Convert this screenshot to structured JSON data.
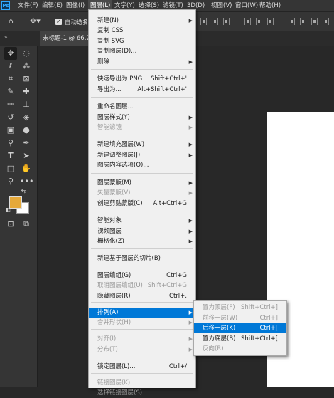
{
  "menubar": {
    "items": [
      "文件(F)",
      "编辑(E)",
      "图像(I)",
      "图层(L)",
      "文字(Y)",
      "选择(S)",
      "滤镜(T)",
      "3D(D)",
      "视图(V)",
      "窗口(W)",
      "帮助(H)"
    ]
  },
  "options": {
    "auto_select_label": "自动选择"
  },
  "document": {
    "tab_title": "未标题-1 @ 66.7"
  },
  "layer_menu": {
    "items": [
      {
        "label": "新建(N)",
        "shortcut": "",
        "arrow": true,
        "disabled": false
      },
      {
        "label": "复制 CSS",
        "shortcut": "",
        "arrow": false,
        "disabled": false
      },
      {
        "label": "复制 SVG",
        "shortcut": "",
        "arrow": false,
        "disabled": false
      },
      {
        "label": "复制图层(D)...",
        "shortcut": "",
        "arrow": false,
        "disabled": false
      },
      {
        "label": "删除",
        "shortcut": "",
        "arrow": true,
        "disabled": false
      },
      {
        "label": "快速导出为 PNG",
        "shortcut": "Shift+Ctrl+'",
        "arrow": false,
        "disabled": false
      },
      {
        "label": "导出为...",
        "shortcut": "Alt+Shift+Ctrl+'",
        "arrow": false,
        "disabled": false
      },
      {
        "label": "重命名图层...",
        "shortcut": "",
        "arrow": false,
        "disabled": false
      },
      {
        "label": "图层样式(Y)",
        "shortcut": "",
        "arrow": true,
        "disabled": false
      },
      {
        "label": "智能滤镜",
        "shortcut": "",
        "arrow": true,
        "disabled": true
      },
      {
        "label": "新建填充图层(W)",
        "shortcut": "",
        "arrow": true,
        "disabled": false
      },
      {
        "label": "新建调整图层(J)",
        "shortcut": "",
        "arrow": true,
        "disabled": false
      },
      {
        "label": "图层内容选项(O)...",
        "shortcut": "",
        "arrow": false,
        "disabled": false
      },
      {
        "label": "图层蒙版(M)",
        "shortcut": "",
        "arrow": true,
        "disabled": false
      },
      {
        "label": "矢量蒙版(V)",
        "shortcut": "",
        "arrow": true,
        "disabled": true
      },
      {
        "label": "创建剪贴蒙版(C)",
        "shortcut": "Alt+Ctrl+G",
        "arrow": false,
        "disabled": false
      },
      {
        "label": "智能对象",
        "shortcut": "",
        "arrow": true,
        "disabled": false
      },
      {
        "label": "视频图层",
        "shortcut": "",
        "arrow": true,
        "disabled": false
      },
      {
        "label": "栅格化(Z)",
        "shortcut": "",
        "arrow": true,
        "disabled": false
      },
      {
        "label": "新建基于图层的切片(B)",
        "shortcut": "",
        "arrow": false,
        "disabled": false
      },
      {
        "label": "图层编组(G)",
        "shortcut": "Ctrl+G",
        "arrow": false,
        "disabled": false
      },
      {
        "label": "取消图层编组(U)",
        "shortcut": "Shift+Ctrl+G",
        "arrow": false,
        "disabled": true
      },
      {
        "label": "隐藏图层(R)",
        "shortcut": "Ctrl+,",
        "arrow": false,
        "disabled": false
      },
      {
        "label": "排列(A)",
        "shortcut": "",
        "arrow": true,
        "disabled": false,
        "highlight": true
      },
      {
        "label": "合并形状(H)",
        "shortcut": "",
        "arrow": true,
        "disabled": true
      },
      {
        "label": "对齐(I)",
        "shortcut": "",
        "arrow": true,
        "disabled": true
      },
      {
        "label": "分布(T)",
        "shortcut": "",
        "arrow": true,
        "disabled": true
      },
      {
        "label": "锁定图层(L)...",
        "shortcut": "Ctrl+/",
        "arrow": false,
        "disabled": false
      },
      {
        "label": "链接图层(K)",
        "shortcut": "",
        "arrow": false,
        "disabled": true
      },
      {
        "label": "选择链接图层(S)",
        "shortcut": "",
        "arrow": false,
        "disabled": true
      }
    ]
  },
  "arrange_menu": {
    "items": [
      {
        "label": "置为顶层(F)",
        "shortcut": "Shift+Ctrl+]",
        "disabled": true
      },
      {
        "label": "前移一层(W)",
        "shortcut": "Ctrl+]",
        "disabled": true
      },
      {
        "label": "后移一层(K)",
        "shortcut": "Ctrl+[",
        "disabled": false,
        "highlight": true
      },
      {
        "label": "置为底层(B)",
        "shortcut": "Shift+Ctrl+[",
        "disabled": false
      },
      {
        "label": "反向(R)",
        "shortcut": "",
        "disabled": true
      }
    ]
  },
  "colors": {
    "foreground": "#e6a93a",
    "background": "#ffffff",
    "highlight": "#0078d7"
  }
}
